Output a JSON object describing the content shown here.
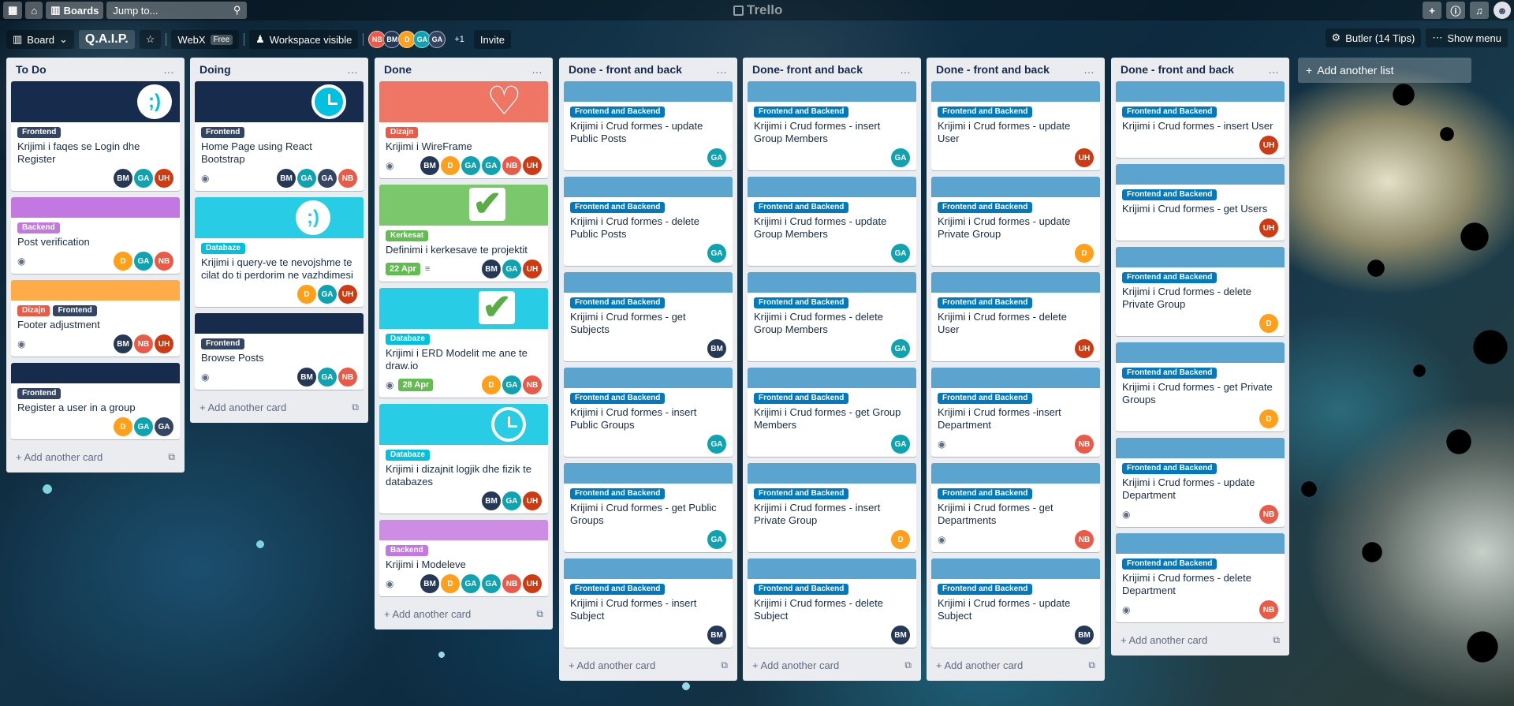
{
  "topbar": {
    "boards_label": "Boards",
    "search_placeholder": "Jump to...",
    "logo": "Trello"
  },
  "header": {
    "board_view": "Board",
    "title": "Q.A.I.P.",
    "workspace": "WebX",
    "workspace_plan": "Free",
    "visibility": "Workspace visible",
    "members_more": "+1",
    "invite": "Invite",
    "butler": "Butler (14 Tips)",
    "show_menu": "Show menu"
  },
  "members": [
    {
      "initials": "NB",
      "color": "#eb5a46"
    },
    {
      "initials": "BM",
      "color": "#253858"
    },
    {
      "initials": "D",
      "color": "#ff9f1a"
    },
    {
      "initials": "GA",
      "color": "#0fa3b1"
    },
    {
      "initials": "GA",
      "color": "#344563"
    }
  ],
  "add_card_label": "Add another card",
  "add_list_label": "Add another list",
  "colors": {
    "frontend": "#344563",
    "backend": "#c377e0",
    "databaze": "#00c2e0",
    "dizajn": "#eb5a46",
    "kerkesat": "#61bd4f",
    "frontback": "#0079bf",
    "cover_blue": "#5ba4cf"
  },
  "lists": [
    {
      "name": "To Do",
      "cards": [
        {
          "labels": [
            "Frontend"
          ],
          "title": "Krijimi i faqes se Login dhe Register",
          "members": [
            "BM",
            "GA",
            "UH"
          ]
        },
        {
          "labels": [
            "Backend"
          ],
          "title": "Post verification",
          "members": [
            "D",
            "GA",
            "NB"
          ]
        },
        {
          "labels": [
            "Dizajn",
            "Frontend"
          ],
          "title": "Footer adjustment",
          "members": [
            "BM",
            "NB",
            "UH"
          ]
        },
        {
          "labels": [
            "Frontend"
          ],
          "title": "Register a user in a group",
          "members": [
            "D",
            "GA",
            "GA"
          ]
        }
      ]
    },
    {
      "name": "Doing",
      "cards": [
        {
          "labels": [
            "Frontend"
          ],
          "title": "Home Page using React Bootstrap",
          "members": [
            "BM",
            "GA",
            "GA",
            "NB"
          ]
        },
        {
          "labels": [
            "Databaze"
          ],
          "title": "Krijimi i query-ve te nevojshme te cilat do ti perdorim ne vazhdimesi",
          "members": [
            "D",
            "GA",
            "UH"
          ]
        },
        {
          "labels": [
            "Frontend"
          ],
          "title": "Browse Posts",
          "members": [
            "BM",
            "GA",
            "NB"
          ]
        }
      ]
    },
    {
      "name": "Done",
      "cards": [
        {
          "labels": [
            "Dizajn"
          ],
          "title": "Krijimi i WireFrame",
          "members": [
            "BM",
            "D",
            "GA",
            "GA",
            "NB",
            "UH"
          ]
        },
        {
          "labels": [
            "Kerkesat"
          ],
          "title": "Definimi i kerkesave te projektit",
          "due": "22 Apr",
          "members": [
            "BM",
            "GA",
            "UH"
          ]
        },
        {
          "labels": [
            "Databaze"
          ],
          "title": "Krijimi i ERD Modelit me ane te draw.io",
          "due": "28 Apr",
          "members": [
            "D",
            "GA",
            "NB"
          ]
        },
        {
          "labels": [
            "Databaze"
          ],
          "title": "Krijimi i dizajnit logjik dhe fizik te databazes",
          "members": [
            "BM",
            "GA",
            "UH"
          ]
        },
        {
          "labels": [
            "Backend"
          ],
          "title": "Krijimi i Modeleve",
          "members": [
            "BM",
            "D",
            "GA",
            "GA",
            "NB",
            "UH"
          ]
        }
      ]
    },
    {
      "name": "Done - front and back",
      "cards": [
        {
          "labels": [
            "Frontend and Backend"
          ],
          "title": "Krijimi i Crud formes - update Public Posts",
          "members": [
            "GA"
          ]
        },
        {
          "labels": [
            "Frontend and Backend"
          ],
          "title": "Krijimi i Crud formes - delete Public Posts",
          "members": [
            "GA"
          ]
        },
        {
          "labels": [
            "Frontend and Backend"
          ],
          "title": "Krijimi i Crud formes - get Subjects",
          "members": [
            "BM"
          ]
        },
        {
          "labels": [
            "Frontend and Backend"
          ],
          "title": "Krijimi i Crud formes - insert Public Groups",
          "members": [
            "GA"
          ]
        },
        {
          "labels": [
            "Frontend and Backend"
          ],
          "title": "Krijimi i Crud formes - get Public Groups",
          "members": [
            "GA"
          ]
        },
        {
          "labels": [
            "Frontend and Backend"
          ],
          "title": "Krijimi i Crud formes - insert Subject",
          "members": [
            "BM"
          ]
        }
      ]
    },
    {
      "name": "Done- front and back",
      "cards": [
        {
          "labels": [
            "Frontend and Backend"
          ],
          "title": "Krijimi i Crud formes - insert Group Members",
          "members": [
            "GA"
          ]
        },
        {
          "labels": [
            "Frontend and Backend"
          ],
          "title": "Krijimi i Crud formes - update Group Members",
          "members": [
            "GA"
          ]
        },
        {
          "labels": [
            "Frontend and Backend"
          ],
          "title": "Krijimi i Crud formes - delete Group Members",
          "members": [
            "GA"
          ]
        },
        {
          "labels": [
            "Frontend and Backend"
          ],
          "title": "Krijimi i Crud formes - get Group Members",
          "members": [
            "GA"
          ]
        },
        {
          "labels": [
            "Frontend and Backend"
          ],
          "title": "Krijimi i Crud formes - insert Private Group",
          "members": [
            "D"
          ]
        },
        {
          "labels": [
            "Frontend and Backend"
          ],
          "title": "Krijimi i Crud formes - delete Subject",
          "members": [
            "BM"
          ]
        }
      ]
    },
    {
      "name": "Done - front and back",
      "cards": [
        {
          "labels": [
            "Frontend and Backend"
          ],
          "title": "Krijimi i Crud formes - update User",
          "members": [
            "UH"
          ]
        },
        {
          "labels": [
            "Frontend and Backend"
          ],
          "title": "Krijimi i Crud formes - update Private Group",
          "members": [
            "D"
          ]
        },
        {
          "labels": [
            "Frontend and Backend"
          ],
          "title": "Krijimi i Crud formes - delete User",
          "members": [
            "UH"
          ]
        },
        {
          "labels": [
            "Frontend and Backend"
          ],
          "title": "Krijimi i Crud formes -insert Department",
          "members": [
            "NB"
          ]
        },
        {
          "labels": [
            "Frontend and Backend"
          ],
          "title": "Krijimi i Crud formes - get Departments",
          "members": [
            "NB"
          ]
        },
        {
          "labels": [
            "Frontend and Backend"
          ],
          "title": "Krijimi i Crud formes - update Subject",
          "members": [
            "BM"
          ]
        }
      ]
    },
    {
      "name": "Done - front and back",
      "cards": [
        {
          "labels": [
            "Frontend and Backend"
          ],
          "title": "Krijimi i Crud formes - insert User",
          "members": [
            "UH"
          ]
        },
        {
          "labels": [
            "Frontend and Backend"
          ],
          "title": "Krijimi i Crud formes - get Users",
          "members": [
            "UH"
          ]
        },
        {
          "labels": [
            "Frontend and Backend"
          ],
          "title": "Krijimi i Crud formes - delete Private Group",
          "members": [
            "D"
          ]
        },
        {
          "labels": [
            "Frontend and Backend"
          ],
          "title": "Krijimi i Crud formes - get Private Groups",
          "members": [
            "D"
          ]
        },
        {
          "labels": [
            "Frontend and Backend"
          ],
          "title": "Krijimi i Crud formes - update Department",
          "members": [
            "NB"
          ]
        },
        {
          "labels": [
            "Frontend and Backend"
          ],
          "title": "Krijimi i Crud formes - delete Department",
          "members": [
            "NB"
          ]
        }
      ]
    }
  ]
}
